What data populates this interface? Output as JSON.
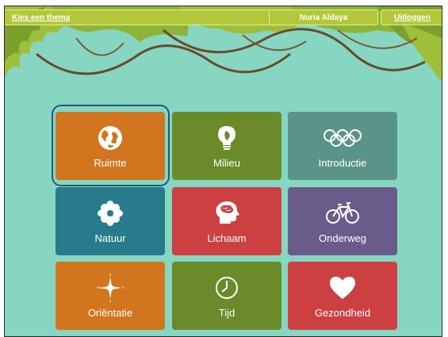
{
  "header": {
    "theme_link": "Kies een thema",
    "user_name": "Nuria Aldaya",
    "logout_link": "Uitloggen"
  },
  "colors": {
    "background": "#86d6c2",
    "top_bar": "#b2c83a",
    "orange": "#d2751f",
    "green": "#6b8a2a",
    "gray_green": "#5a9488",
    "teal": "#277b8a",
    "red": "#cd4042",
    "purple": "#6a5c8a",
    "selection_ring": "#1e5b7e"
  },
  "themes": [
    {
      "label": "Ruimte",
      "icon": "globe-icon",
      "color": "#d2751f",
      "selected": true
    },
    {
      "label": "Milieu",
      "icon": "lightbulb-leaf-icon",
      "color": "#6b8a2a",
      "selected": false
    },
    {
      "label": "Introductie",
      "icon": "olympic-rings-icon",
      "color": "#5a9488",
      "selected": false
    },
    {
      "label": "Natuur",
      "icon": "flower-icon",
      "color": "#277b8a",
      "selected": false
    },
    {
      "label": "Lichaam",
      "icon": "head-brain-icon",
      "color": "#cd4042",
      "selected": false
    },
    {
      "label": "Onderweg",
      "icon": "bicycle-icon",
      "color": "#6a5c8a",
      "selected": false
    },
    {
      "label": "Oriëntatie",
      "icon": "compass-icon",
      "color": "#d2751f",
      "selected": false
    },
    {
      "label": "Tijd",
      "icon": "clock-icon",
      "color": "#6b8a2a",
      "selected": false
    },
    {
      "label": "Gezondheid",
      "icon": "heart-icon",
      "color": "#cd4042",
      "selected": false
    }
  ]
}
